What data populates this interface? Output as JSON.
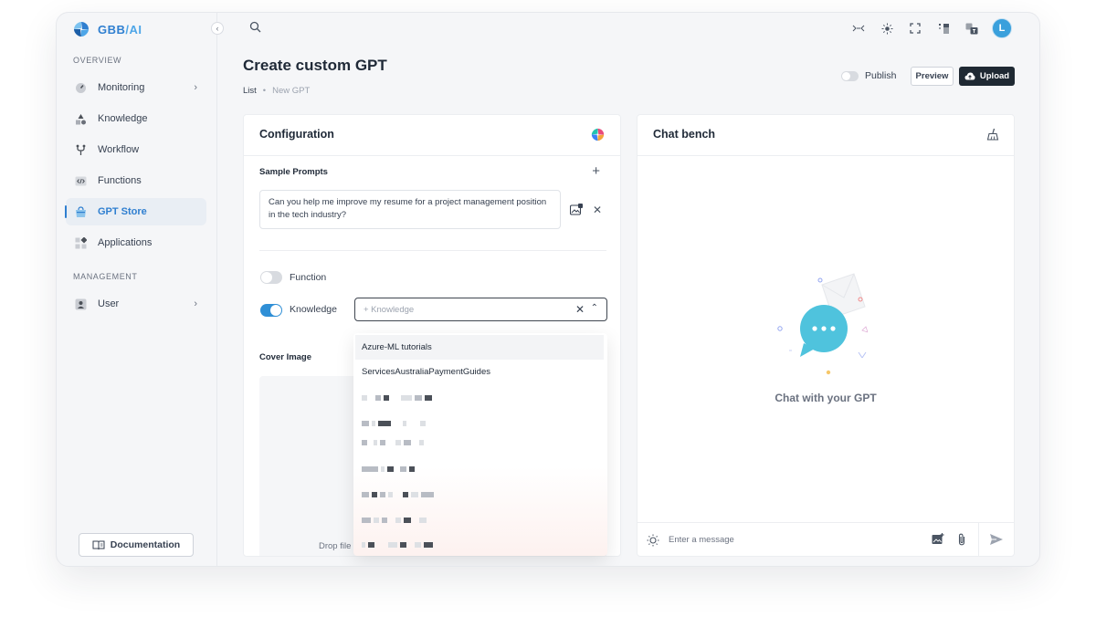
{
  "brand": {
    "name": "GBB",
    "suffix": "/AI"
  },
  "sidebar": {
    "overview_title": "OVERVIEW",
    "management_title": "MANAGEMENT",
    "items": [
      {
        "label": "Monitoring",
        "icon": "gauge-icon",
        "has_chevron": true
      },
      {
        "label": "Knowledge",
        "icon": "shapes-icon",
        "has_chevron": false
      },
      {
        "label": "Workflow",
        "icon": "fork-icon",
        "has_chevron": false
      },
      {
        "label": "Functions",
        "icon": "code-icon",
        "has_chevron": false
      },
      {
        "label": "GPT Store",
        "icon": "store-icon",
        "has_chevron": false,
        "active": true
      },
      {
        "label": "Applications",
        "icon": "apps-grid-icon",
        "has_chevron": false
      }
    ],
    "management_items": [
      {
        "label": "User",
        "icon": "user-icon",
        "has_chevron": true
      }
    ],
    "documentation_label": "Documentation"
  },
  "header": {
    "title": "Create custom GPT",
    "breadcrumb": {
      "root": "List",
      "current": "New GPT"
    },
    "publish_label": "Publish",
    "preview_label": "Preview",
    "upload_label": "Upload",
    "avatar_initial": "L"
  },
  "configuration": {
    "title": "Configuration",
    "sample_prompts_label": "Sample Prompts",
    "prompt_text": "Can you help me improve my resume for a project management position in the tech industry?",
    "function_label": "Function",
    "function_enabled": false,
    "knowledge_label": "Knowledge",
    "knowledge_enabled": true,
    "knowledge_placeholder": "+ Knowledge",
    "cover_image_label": "Cover Image",
    "drop_text": "Drop file"
  },
  "knowledge_dropdown": {
    "options": [
      "Azure-ML tutorials",
      "ServicesAustraliaPaymentGuides"
    ]
  },
  "chat": {
    "title": "Chat bench",
    "hint": "Chat with your GPT",
    "input_placeholder": "Enter a message"
  },
  "colors": {
    "accent": "#2f7fd0",
    "upload_bg": "#1f2933",
    "toggle_on": "#2f8fd6",
    "chat_bubble": "#4fc3dd"
  }
}
